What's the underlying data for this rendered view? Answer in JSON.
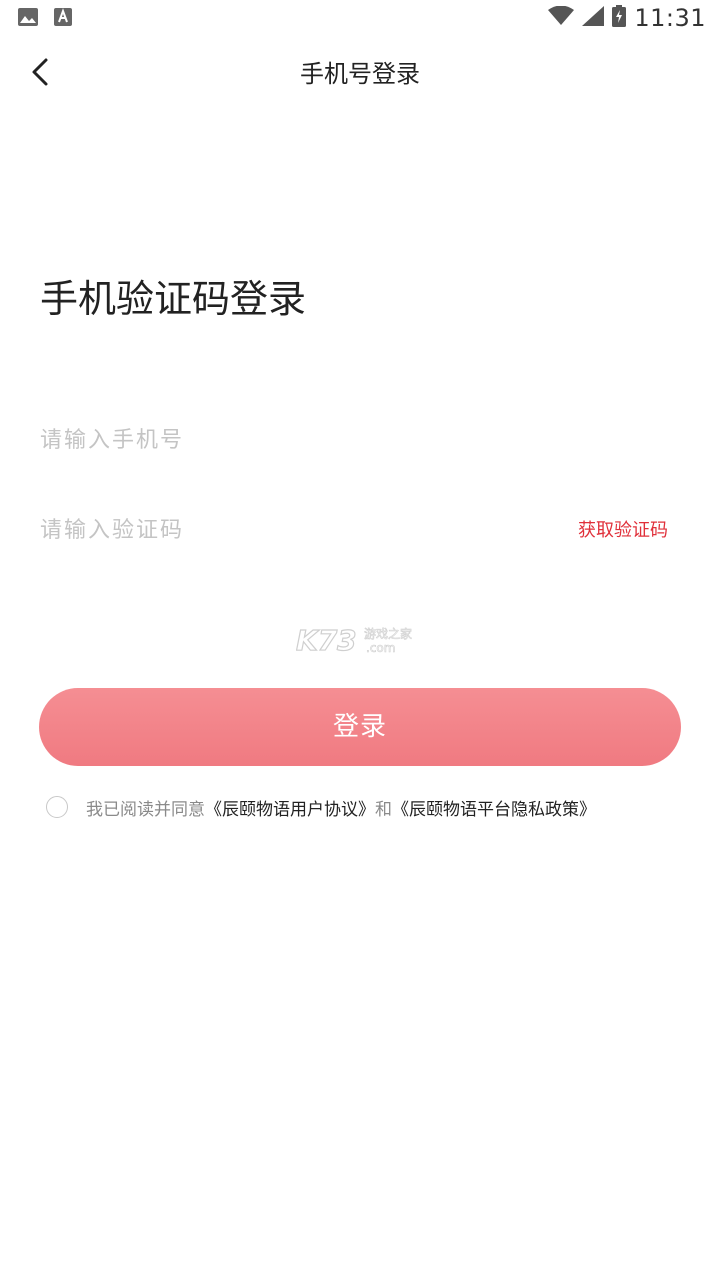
{
  "status_bar": {
    "time": "11:31",
    "icons": [
      "image-icon",
      "font-icon",
      "wifi-icon",
      "signal-icon",
      "battery-charging-icon"
    ]
  },
  "header": {
    "title": "手机号登录",
    "back_icon": "chevron-left-icon"
  },
  "main": {
    "title": "手机验证码登录",
    "phone_placeholder": "请输入手机号",
    "phone_value": "",
    "code_placeholder": "请输入验证码",
    "code_value": "",
    "get_code_label": "获取验证码",
    "login_label": "登录"
  },
  "watermark": {
    "brand": "K73",
    "line1": "游戏之家",
    "line2": ".com"
  },
  "agreement": {
    "prefix": "我已阅读并同意",
    "user_agreement": "《辰颐物语用户协议》",
    "conjunction": "和",
    "privacy_policy": "《辰颐物语平台隐私政策》"
  },
  "colors": {
    "accent": "#e0303a",
    "button": "#f2848a",
    "placeholder": "#c4c4c4"
  }
}
